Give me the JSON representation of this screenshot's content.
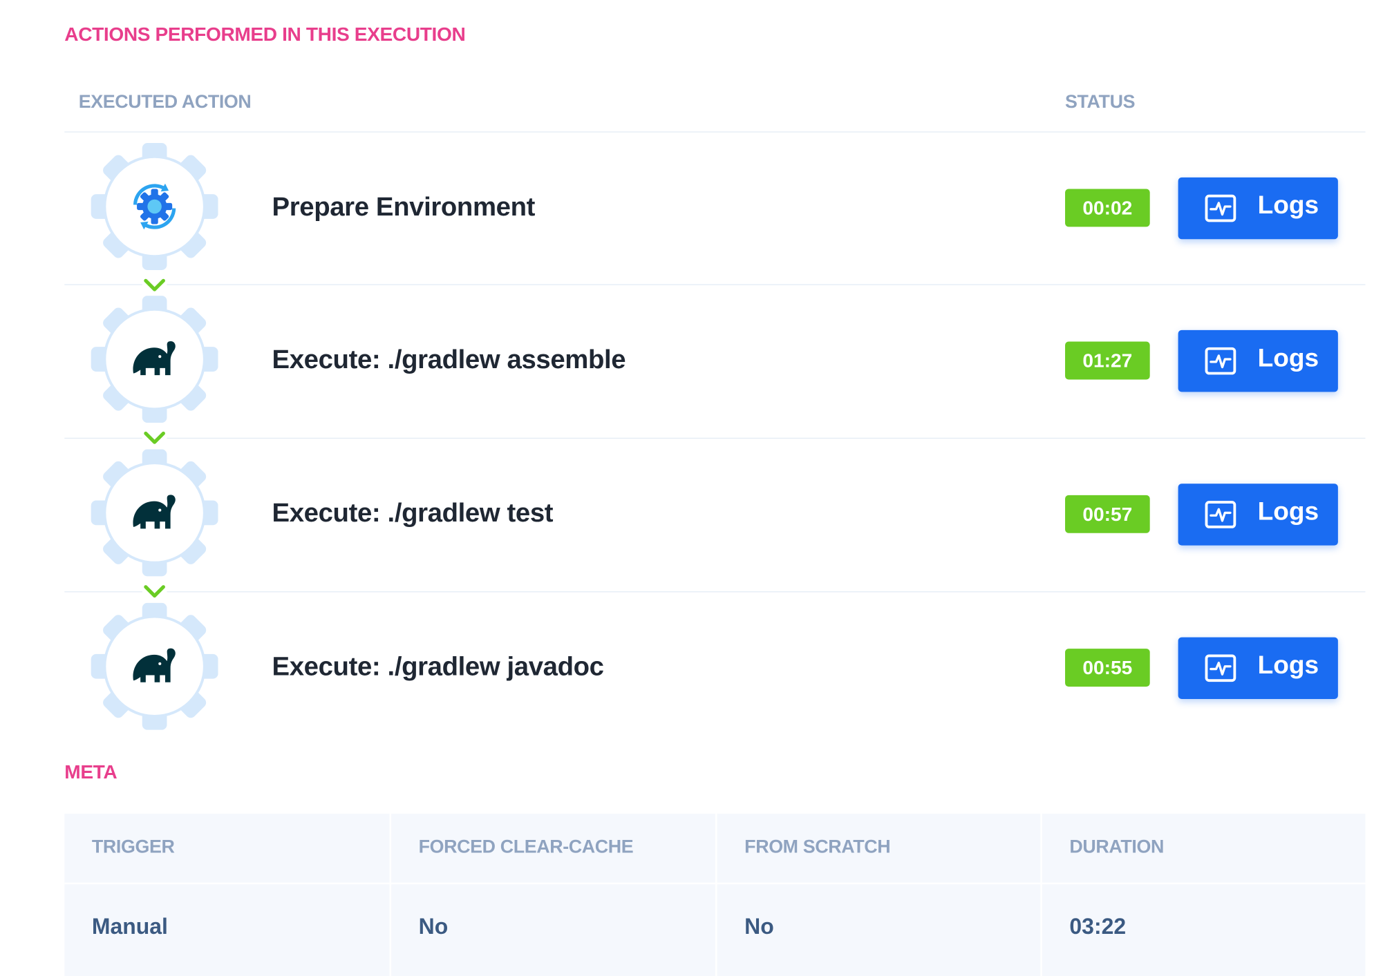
{
  "sections": {
    "actions_title": "ACTIONS PERFORMED IN THIS EXECUTION",
    "meta_title": "META"
  },
  "table": {
    "col_action": "EXECUTED ACTION",
    "col_status": "STATUS"
  },
  "actions": [
    {
      "name": "Prepare Environment",
      "duration": "00:02",
      "logs_label": "Logs",
      "icon": "sync-gear-icon"
    },
    {
      "name": "Execute: ./gradlew assemble",
      "duration": "01:27",
      "logs_label": "Logs",
      "icon": "gradle-elephant-icon"
    },
    {
      "name": "Execute: ./gradlew test",
      "duration": "00:57",
      "logs_label": "Logs",
      "icon": "gradle-elephant-icon"
    },
    {
      "name": "Execute: ./gradlew javadoc",
      "duration": "00:55",
      "logs_label": "Logs",
      "icon": "gradle-elephant-icon"
    }
  ],
  "meta": {
    "headers": [
      "TRIGGER",
      "FORCED CLEAR-CACHE",
      "FROM SCRATCH",
      "DURATION"
    ],
    "values": [
      "Manual",
      "No",
      "No",
      "03:22"
    ]
  },
  "colors": {
    "accent_pink": "#e83e8c",
    "header_gray": "#8fa3c0",
    "status_green": "#6acc24",
    "button_blue": "#1a6cf2",
    "gear_light": "#d5e8fb",
    "meta_value": "#3b5a82"
  }
}
